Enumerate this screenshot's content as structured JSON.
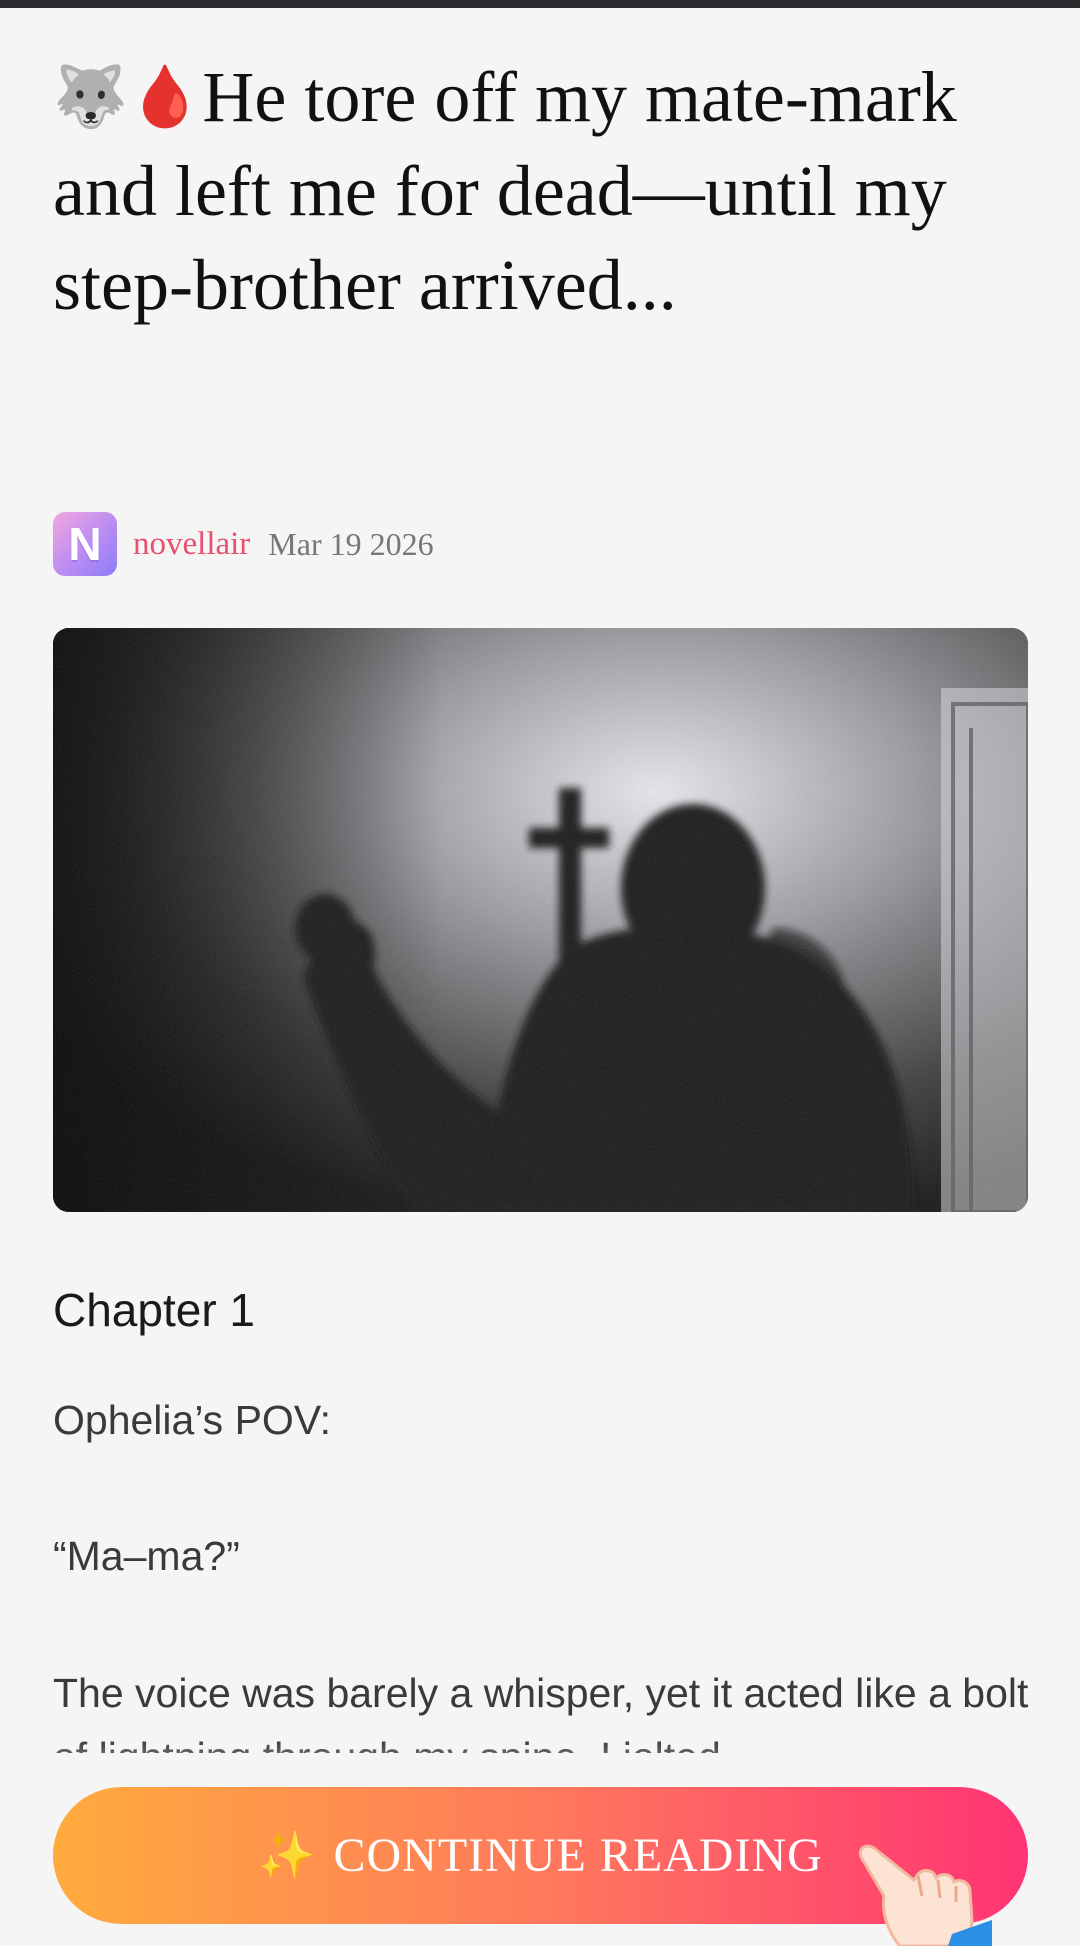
{
  "article": {
    "title_emojis": "🐺🩸",
    "title": "He tore off my mate-mark and left me for dead—until my step-brother arrived..."
  },
  "author": {
    "avatar_letter": "N",
    "name": "novellair",
    "date": "Mar 19 2026"
  },
  "content": {
    "chapter": "Chapter 1",
    "paragraphs": [
      "Ophelia’s POV:",
      "“Ma–ma?”",
      "The voice was barely a whisper, yet it acted like a bolt of lightning through my spine. I jolted"
    ]
  },
  "cta": {
    "sparkle": "✨",
    "label": "CONTINUE READING"
  },
  "colors": {
    "accent_author": "#e8506e",
    "cta_start": "#ffab3d",
    "cta_end": "#ff3474"
  },
  "icons": {
    "cta_left": "sparkles-icon",
    "cta_right": "pointing-hand-icon"
  }
}
